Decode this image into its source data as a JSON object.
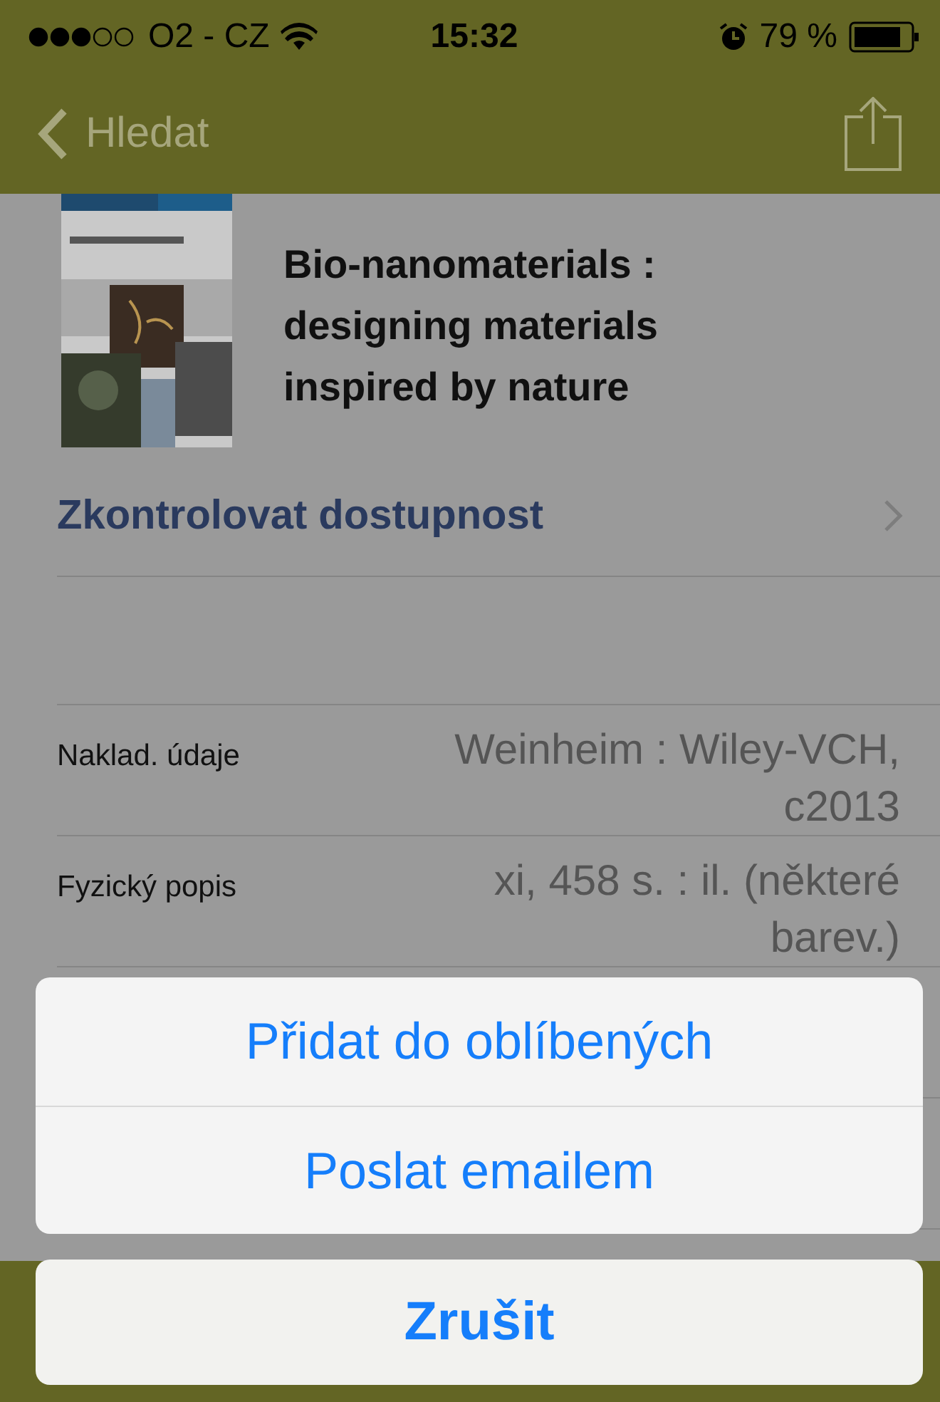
{
  "status_bar": {
    "carrier": "O2 - CZ",
    "time": "15:32",
    "battery": "79 %"
  },
  "nav": {
    "back": "Hledat"
  },
  "book": {
    "title": "Bio-nanomaterials : designing materials inspired by nature"
  },
  "availability": {
    "label": "Zkontrolovat dostupnost"
  },
  "details": [
    {
      "label": "Naklad. údaje",
      "value": "Weinheim : Wiley-VCH, c2013"
    },
    {
      "label": "Fyzický popis",
      "value": "xi, 458 s. : il. (některé barev.)"
    }
  ],
  "action_sheet": {
    "actions": [
      "Přidat do oblíbených",
      "Poslat emailem"
    ],
    "cancel": "Zrušit"
  }
}
